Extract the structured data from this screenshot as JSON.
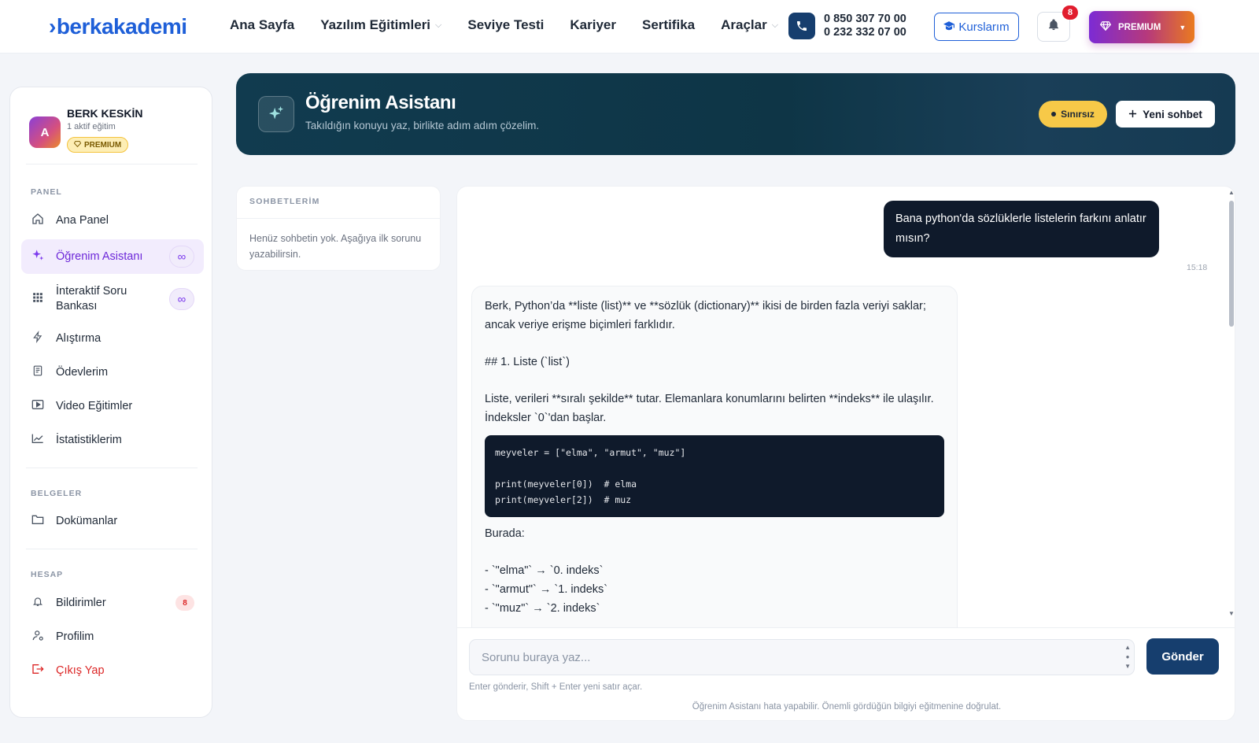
{
  "header": {
    "logo_mark": "›",
    "logo_text": "berkakademi",
    "nav": [
      {
        "label": "Ana Sayfa",
        "has_dropdown": false
      },
      {
        "label": "Yazılım Eğitimleri",
        "has_dropdown": true
      },
      {
        "label": "Seviye Testi",
        "has_dropdown": false
      },
      {
        "label": "Kariyer",
        "has_dropdown": false
      },
      {
        "label": "Sertifika",
        "has_dropdown": false
      },
      {
        "label": "Araçlar",
        "has_dropdown": true
      }
    ],
    "phone1": "0 850 307 70 00",
    "phone2": "0 232 332 07 00",
    "courses_label": "Kurslarım",
    "notification_count": "8",
    "premium_label": "PREMIUM"
  },
  "sidebar": {
    "avatar_letter": "A",
    "user_name": "BERK KESKİN",
    "user_sub": "1 aktif eğitim",
    "user_badge": "PREMIUM",
    "sections": {
      "panel": "PANEL",
      "belgeler": "BELGELER",
      "hesap": "HESAP"
    },
    "items": {
      "ana_panel": "Ana Panel",
      "ogrenim_asistani": "Öğrenim Asistanı",
      "soru_bankasi_1": "İnteraktif Soru",
      "soru_bankasi_2": "Bankası",
      "alistirma": "Alıştırma",
      "odevlerim": "Ödevlerim",
      "video": "Video Eğitimler",
      "istatistik": "İstatistiklerim",
      "dokumanlar": "Dokümanlar",
      "bildirimler": "Bildirimler",
      "bildirim_count": "8",
      "profilim": "Profilim",
      "cikis": "Çıkış Yap"
    },
    "infinity": "∞"
  },
  "banner": {
    "title": "Öğrenim Asistanı",
    "subtitle": "Takıldığın konuyu yaz, birlikte adım adım çözelim.",
    "badge": "Sınırsız",
    "new_chat": "Yeni sohbet"
  },
  "chats": {
    "title": "SOHBETLERİM",
    "empty": "Henüz sohbetin yok. Aşağıya ilk sorunu yazabilirsin."
  },
  "conversation": {
    "user_message": "Bana python'da sözlüklerle listelerin farkını anlatır mısın?",
    "user_time": "15:18",
    "assistant": {
      "p1": "Berk, Python’da **liste (list)** ve **sözlük (dictionary)** ikisi de birden fazla veriyi saklar; ancak veriye erişme biçimleri farklıdır.",
      "p2": "## 1. Liste (`list`)",
      "p3": "Liste, verileri **sıralı şekilde** tutar. Elemanlara konumlarını belirten **indeks** ile ulaşılır. İndeksler `0`'dan başlar.",
      "code": "meyveler = [\"elma\", \"armut\", \"muz\"]\n\nprint(meyveler[0])  # elma\nprint(meyveler[2])  # muz",
      "p4": "Burada:",
      "bullets": [
        "- `\"elma\"` → `0. indeks`",
        "- `\"armut\"` → `1. indeks`",
        "- `\"muz\"` → `2. indeks`"
      ]
    }
  },
  "composer": {
    "placeholder": "Sorunu buraya yaz...",
    "send_label": "Gönder",
    "hint": "Enter gönderir, Shift + Enter yeni satır açar.",
    "disclaimer": "Öğrenim Asistanı hata yapabilir. Önemli gördüğün bilgiyi eğitmenine doğrulat."
  },
  "colors": {
    "brand_blue": "#1e5fd8",
    "navy": "#163e6e",
    "active_purple": "#7c3aed",
    "danger": "#dc2626",
    "yellow": "#f7c948"
  }
}
